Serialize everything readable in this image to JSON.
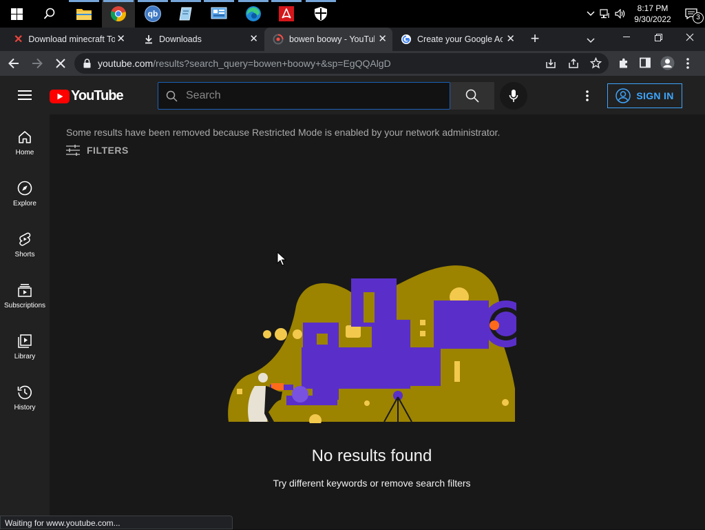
{
  "taskbar": {
    "apps": [
      {
        "name": "search-icon"
      },
      {
        "name": "file-explorer-icon"
      },
      {
        "name": "chrome-icon"
      },
      {
        "name": "qbittorrent-icon",
        "label": "qb"
      },
      {
        "name": "notepad-icon"
      },
      {
        "name": "control-panel-icon"
      },
      {
        "name": "edge-icon"
      },
      {
        "name": "adobe-reader-icon"
      },
      {
        "name": "security-shield-icon"
      }
    ],
    "time": "8:17 PM",
    "date": "9/30/2022",
    "notification_count": "3"
  },
  "browser": {
    "tabs": [
      {
        "title": "Download minecraft To",
        "icon": "x-favicon",
        "icon_color": "#e8453c"
      },
      {
        "title": "Downloads",
        "icon": "download-favicon"
      },
      {
        "title": "bowen boowy - YouTub",
        "icon": "youtube-loading-favicon",
        "active": true
      },
      {
        "title": "Create your Google Ac",
        "icon": "google-favicon"
      }
    ],
    "new_tab_label": "+",
    "url_host": "youtube.com",
    "url_path": "/results?search_query=bowen+boowy+&sp=EgQQAlgD",
    "status_text": "Waiting for www.youtube.com..."
  },
  "youtube": {
    "logo_text": "YouTube",
    "search_placeholder": "Search",
    "signin_label": "SIGN IN",
    "guide": [
      {
        "label": "Home",
        "icon": "home-icon"
      },
      {
        "label": "Explore",
        "icon": "compass-icon"
      },
      {
        "label": "Shorts",
        "icon": "shorts-icon"
      },
      {
        "label": "Subscriptions",
        "icon": "subscriptions-icon"
      },
      {
        "label": "Library",
        "icon": "library-icon"
      },
      {
        "label": "History",
        "icon": "history-icon"
      }
    ],
    "restricted_notice": "Some results have been removed because Restricted Mode is enabled by your network administrator.",
    "filters_label": "FILTERS",
    "no_results_title": "No results found",
    "no_results_hint": "Try different keywords or remove search filters"
  },
  "colors": {
    "brand_red": "#ff0000",
    "link_blue": "#3ea6ff",
    "illustration_gold": "#9c8300",
    "illustration_purple": "#5a2fc9"
  }
}
